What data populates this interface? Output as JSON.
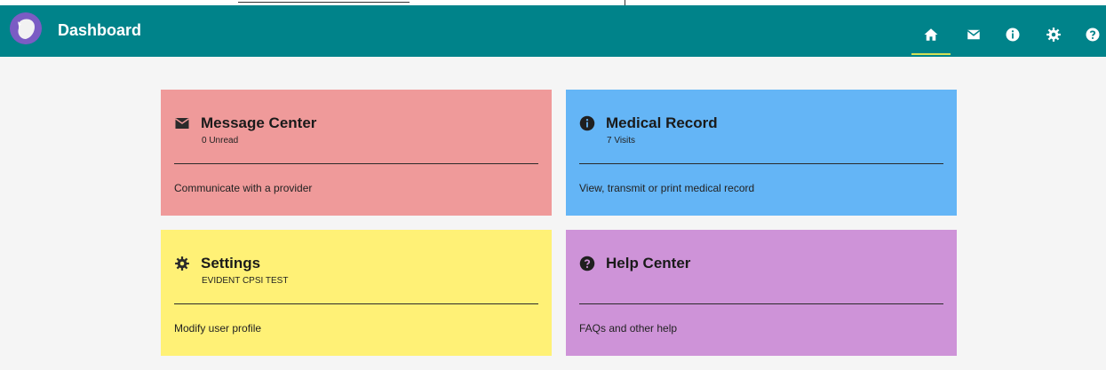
{
  "app_bar": {
    "title": "Dashboard",
    "background": "#00838a",
    "nav": [
      {
        "icon": "home-icon",
        "active": true
      },
      {
        "icon": "mail-icon",
        "active": false
      },
      {
        "icon": "info-icon",
        "active": false
      },
      {
        "icon": "gear-icon",
        "active": false
      },
      {
        "icon": "help-icon",
        "active": false
      }
    ]
  },
  "cards": {
    "message_center": {
      "icon": "envelope-icon",
      "title": "Message Center",
      "subtitle": "0 Unread",
      "description": "Communicate with a provider",
      "color": "#ef9a9a"
    },
    "medical_record": {
      "icon": "info-icon",
      "title": "Medical Record",
      "subtitle": "7 Visits",
      "description": "View, transmit or print medical record",
      "color": "#64b5f6"
    },
    "settings": {
      "icon": "gear-icon",
      "title": "Settings",
      "subtitle": "EVIDENT CPSI TEST",
      "description": "Modify user profile",
      "color": "#fff176"
    },
    "help_center": {
      "icon": "help-icon",
      "title": "Help Center",
      "subtitle": "",
      "description": "FAQs and other help",
      "color": "#ce93d8"
    }
  }
}
